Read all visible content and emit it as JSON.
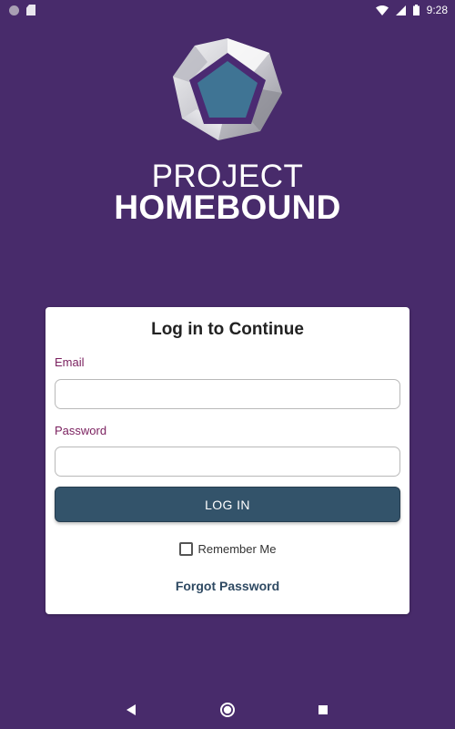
{
  "status_bar": {
    "time": "9:28",
    "icons": [
      "notification-dot-icon",
      "sd-card-icon",
      "wifi-icon",
      "signal-icon",
      "battery-icon"
    ]
  },
  "brand": {
    "line1": "PROJECT",
    "line2": "HOMEBOUND",
    "logo_icon": "pentagon-logo-icon"
  },
  "login_card": {
    "title": "Log in to Continue",
    "email_label": "Email",
    "email_value": "",
    "password_label": "Password",
    "password_value": "",
    "login_button": "LOG IN",
    "remember_label": "Remember Me",
    "remember_checked": false,
    "forgot_link": "Forgot Password"
  },
  "nav_bar": {
    "icons": [
      "back-icon",
      "home-icon",
      "recents-icon"
    ]
  },
  "colors": {
    "background": "#482b6b",
    "button": "#33536a",
    "label": "#7a1f5e",
    "link": "#2f4a63",
    "logo_fill": "#3f7494"
  }
}
